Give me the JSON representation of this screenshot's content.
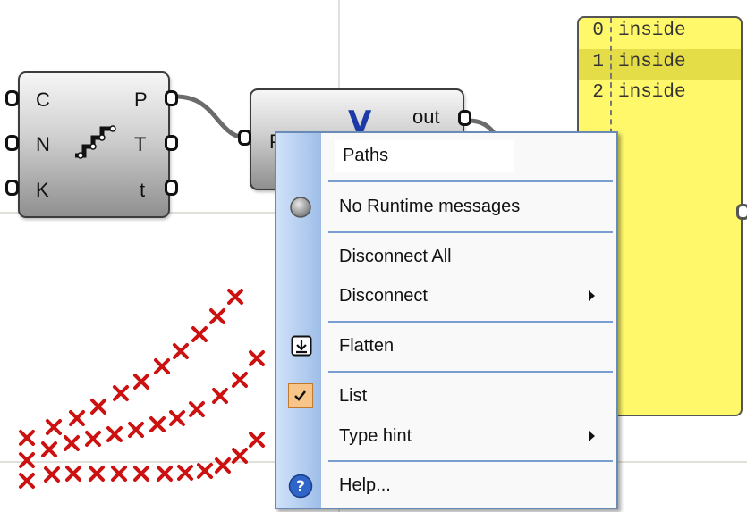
{
  "colors": {
    "canvas_bg": "#ffffff",
    "grid": "#e1e1dc",
    "panel_bg": "#fff86b",
    "panel_highlight": "#e5dd48",
    "menu_accent": "#7b9ed0",
    "point_marker": "#cc1111"
  },
  "component_path": {
    "inputs": [
      "C",
      "N",
      "K"
    ],
    "outputs": [
      "P",
      "T",
      "t"
    ],
    "icon": "stairs-icon"
  },
  "component_tree": {
    "input_label": "P",
    "output_label": "out",
    "icon": "v-icon"
  },
  "panel": {
    "rows": [
      {
        "index": "0",
        "value": "inside"
      },
      {
        "index": "1",
        "value": "inside"
      },
      {
        "index": "2",
        "value": "inside"
      }
    ]
  },
  "menu": {
    "name_value": "Paths",
    "runtime_label": "No Runtime messages",
    "disconnect_all_label": "Disconnect All",
    "disconnect_label": "Disconnect",
    "flatten_label": "Flatten",
    "list_label": "List",
    "type_hint_label": "Type hint",
    "help_label": "Help...",
    "icons": {
      "runtime": "grey-circle-icon",
      "flatten": "flatten-icon",
      "list": "checkmark-icon",
      "help": "help-icon",
      "submenu": "submenu-arrow-icon"
    }
  }
}
